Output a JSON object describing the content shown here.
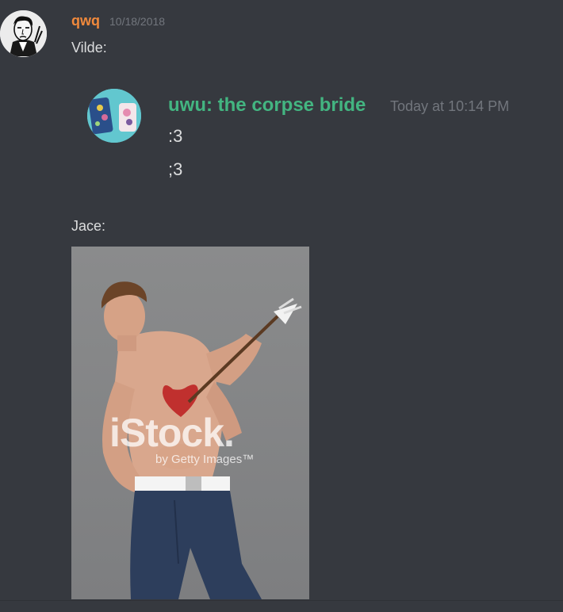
{
  "outer_message": {
    "username": "qwq",
    "timestamp": "10/18/2018",
    "line1": "Vilde:",
    "line2": "Jace:"
  },
  "quoted_message": {
    "username": "uwu: the corpse bride",
    "timestamp": "Today at 10:14 PM",
    "lines": [
      ":3",
      ";3"
    ]
  },
  "attachment": {
    "watermark": "iStock.",
    "watermark_sub": "by Getty Images™"
  },
  "colors": {
    "background": "#36393f",
    "outer_username": "#f0893c",
    "inner_username": "#43b581",
    "text": "#dcddde",
    "muted": "#72767d"
  }
}
